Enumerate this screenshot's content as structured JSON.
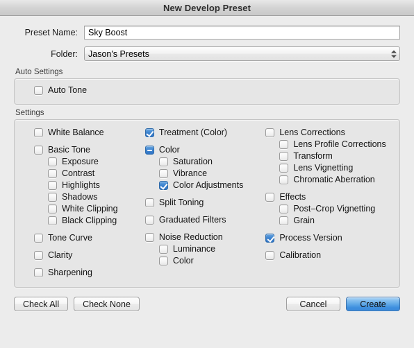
{
  "window": {
    "title": "New Develop Preset"
  },
  "form": {
    "preset_name_label": "Preset Name:",
    "preset_name_value": "Sky Boost",
    "preset_name_placeholder": "",
    "folder_label": "Folder:",
    "folder_value": "Jason's Presets"
  },
  "auto_settings": {
    "title": "Auto Settings",
    "items": [
      {
        "label": "Auto Tone",
        "state": "unchecked"
      }
    ]
  },
  "settings": {
    "title": "Settings",
    "column_1": [
      {
        "label": "White Balance",
        "state": "unchecked",
        "indent": false,
        "spaced": false
      },
      {
        "label": "Basic Tone",
        "state": "unchecked",
        "indent": false,
        "spaced": true
      },
      {
        "label": "Exposure",
        "state": "unchecked",
        "indent": true,
        "spaced": false
      },
      {
        "label": "Contrast",
        "state": "unchecked",
        "indent": true,
        "spaced": false
      },
      {
        "label": "Highlights",
        "state": "unchecked",
        "indent": true,
        "spaced": false
      },
      {
        "label": "Shadows",
        "state": "unchecked",
        "indent": true,
        "spaced": false
      },
      {
        "label": "White Clipping",
        "state": "unchecked",
        "indent": true,
        "spaced": false
      },
      {
        "label": "Black Clipping",
        "state": "unchecked",
        "indent": true,
        "spaced": false
      },
      {
        "label": "Tone Curve",
        "state": "unchecked",
        "indent": false,
        "spaced": true
      },
      {
        "label": "Clarity",
        "state": "unchecked",
        "indent": false,
        "spaced": true
      },
      {
        "label": "Sharpening",
        "state": "unchecked",
        "indent": false,
        "spaced": true
      }
    ],
    "column_2": [
      {
        "label": "Treatment (Color)",
        "state": "checked",
        "indent": false,
        "spaced": false
      },
      {
        "label": "Color",
        "state": "mixed",
        "indent": false,
        "spaced": true
      },
      {
        "label": "Saturation",
        "state": "unchecked",
        "indent": true,
        "spaced": false
      },
      {
        "label": "Vibrance",
        "state": "unchecked",
        "indent": true,
        "spaced": false
      },
      {
        "label": "Color Adjustments",
        "state": "checked",
        "indent": true,
        "spaced": false
      },
      {
        "label": "Split Toning",
        "state": "unchecked",
        "indent": false,
        "spaced": true
      },
      {
        "label": "Graduated Filters",
        "state": "unchecked",
        "indent": false,
        "spaced": true
      },
      {
        "label": "Noise Reduction",
        "state": "unchecked",
        "indent": false,
        "spaced": true
      },
      {
        "label": "Luminance",
        "state": "unchecked",
        "indent": true,
        "spaced": false
      },
      {
        "label": "Color",
        "state": "unchecked",
        "indent": true,
        "spaced": false
      }
    ],
    "column_3": [
      {
        "label": "Lens Corrections",
        "state": "unchecked",
        "indent": false,
        "spaced": false
      },
      {
        "label": "Lens Profile Corrections",
        "state": "unchecked",
        "indent": true,
        "spaced": false
      },
      {
        "label": "Transform",
        "state": "unchecked",
        "indent": true,
        "spaced": false
      },
      {
        "label": "Lens Vignetting",
        "state": "unchecked",
        "indent": true,
        "spaced": false
      },
      {
        "label": "Chromatic Aberration",
        "state": "unchecked",
        "indent": true,
        "spaced": false
      },
      {
        "label": "Effects",
        "state": "unchecked",
        "indent": false,
        "spaced": true
      },
      {
        "label": "Post–Crop Vignetting",
        "state": "unchecked",
        "indent": true,
        "spaced": false
      },
      {
        "label": "Grain",
        "state": "unchecked",
        "indent": true,
        "spaced": false
      },
      {
        "label": "Process Version",
        "state": "checked",
        "indent": false,
        "spaced": true
      },
      {
        "label": "Calibration",
        "state": "unchecked",
        "indent": false,
        "spaced": true
      }
    ]
  },
  "footer": {
    "check_all": "Check All",
    "check_none": "Check None",
    "cancel": "Cancel",
    "create": "Create"
  },
  "colors": {
    "accent": "#3f85d0",
    "primary_button": "#5aa5e6",
    "window_background": "#ececec",
    "group_background": "#e6e6e6"
  }
}
